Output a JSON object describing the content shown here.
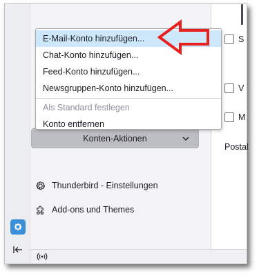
{
  "menu": {
    "items": [
      {
        "label": "E-Mail-Konto hinzufügen...",
        "highlighted": true
      },
      {
        "label": "Chat-Konto hinzufügen..."
      },
      {
        "label": "Feed-Konto hinzufügen..."
      },
      {
        "label": "Newsgruppen-Konto hinzufügen..."
      }
    ],
    "lower_items": [
      {
        "label": "Als Standard festlegen",
        "disabled": true
      },
      {
        "label": "Konto entfernen"
      }
    ]
  },
  "folder_pane": {
    "actions_button_label": "Konten-Aktionen",
    "links": [
      {
        "label": "Thunderbird - Einstellungen",
        "icon": "gear-icon"
      },
      {
        "label": "Add-ons und Themes",
        "icon": "puzzle-icon"
      }
    ]
  },
  "content_pane": {
    "partial_labels": [
      "S",
      "V",
      "M"
    ],
    "bottom_text": "Postal"
  },
  "colors": {
    "menu_highlight": "#cde8fb",
    "accent": "#3b8ed8",
    "annotation": "#e8201f",
    "actions_button": "#bdbdc4"
  }
}
